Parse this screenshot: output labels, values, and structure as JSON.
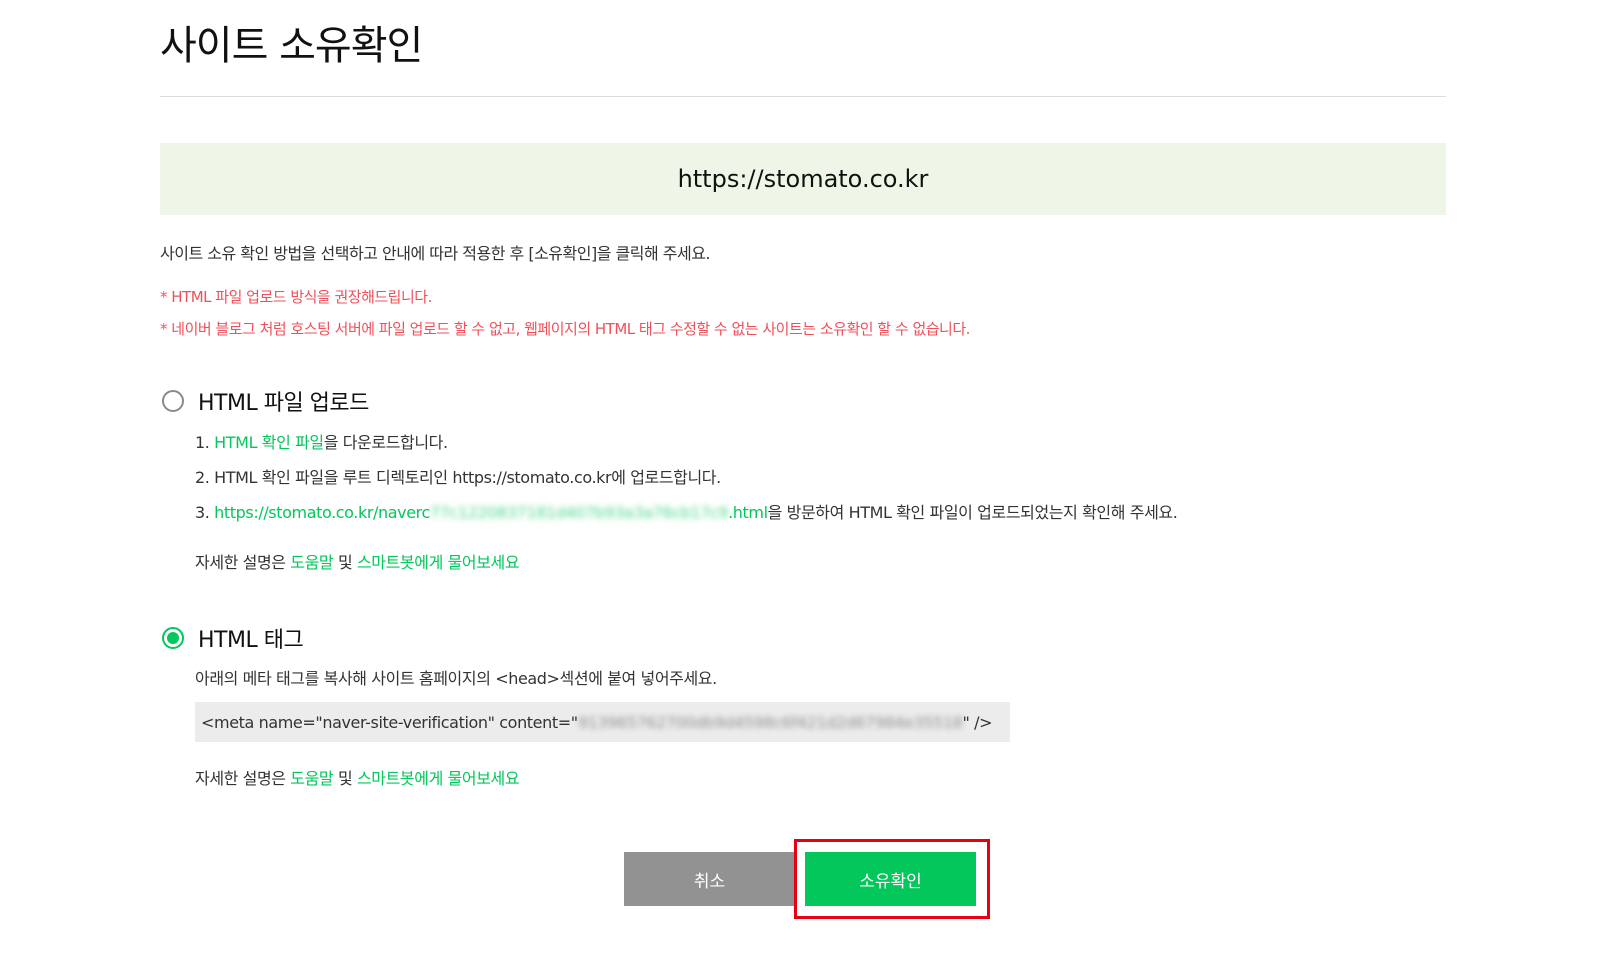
{
  "page": {
    "title": "사이트 소유확인",
    "site_url": "https://stomato.co.kr"
  },
  "intro": "사이트 소유 확인 방법을 선택하고 안내에 따라 적용한 후 [소유확인]을 클릭해 주세요.",
  "notices": [
    "* HTML 파일 업로드 방식을 권장해드립니다.",
    "* 네이버 블로그 처럼 호스팅 서버에 파일 업로드 할 수 없고, 웹페이지의 HTML 태그 수정할 수 없는 사이트는 소유확인 할 수 없습니다."
  ],
  "option_file": {
    "label": "HTML 파일 업로드",
    "selected": false,
    "step1_prefix": "1. ",
    "step1_link": "HTML 확인 파일",
    "step1_suffix": "을 다운로드합니다.",
    "step2": "2. HTML 확인 파일을 루트 디렉토리인 https://stomato.co.kr에 업로드합니다.",
    "step3_prefix": "3. ",
    "step3_link_start": "https://stomato.co.kr/naverc",
    "step3_link_redacted": "77c1220837181d407b93a3a76cb17c9",
    "step3_link_end": ".html",
    "step3_suffix": "을 방문하여 HTML 확인 파일이 업로드되었는지 확인해 주세요.",
    "help_prefix": "자세한 설명은 ",
    "help_link1": "도움말",
    "help_mid": " 및 ",
    "help_link2": "스마트봇에게 물어보세요"
  },
  "option_tag": {
    "label": "HTML 태그",
    "selected": true,
    "description": "아래의 메타 태그를 복사해 사이트 홈페이지의 <head>섹션에 붙여 넣어주세요.",
    "meta_prefix": "<meta name=\"naver-site-verification\" content=\"",
    "meta_redacted": "913965762700db9d4598c6f421d2d67984e35518",
    "meta_suffix": "\" />",
    "help_prefix": "자세한 설명은 ",
    "help_link1": "도움말",
    "help_mid": " 및 ",
    "help_link2": "스마트봇에게 물어보세요"
  },
  "buttons": {
    "cancel": "취소",
    "confirm": "소유확인"
  },
  "colors": {
    "accent": "#03c75a",
    "notice": "#f0505a",
    "banner_bg": "#eef7e7",
    "cancel_bg": "#929292",
    "highlight": "#e60012"
  }
}
